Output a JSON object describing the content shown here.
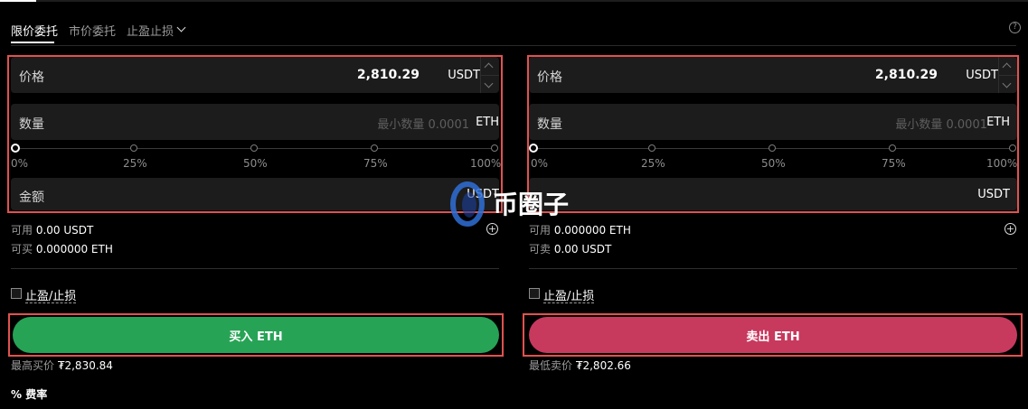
{
  "tabs": {
    "limit": "限价委托",
    "market": "市价委托",
    "tpsl": "止盈止损"
  },
  "buy": {
    "price_label": "价格",
    "price_value": "2,810.29",
    "price_unit": "USDT",
    "qty_label": "数量",
    "qty_placeholder": "最小数量 0.0001",
    "qty_unit": "ETH",
    "slider_marks": [
      "0%",
      "25%",
      "50%",
      "75%",
      "100%"
    ],
    "slider_value_percent": 0,
    "amount_label": "金额",
    "amount_unit": "USDT",
    "available_label": "可用",
    "available_value": "0.00 USDT",
    "can_label": "可买",
    "can_value": "0.000000 ETH",
    "tpsl_label": "止盈/止损",
    "button": "买入 ETH",
    "best_label": "最高买价",
    "best_value": "₮2,830.84",
    "color": "#27a356"
  },
  "sell": {
    "price_label": "价格",
    "price_value": "2,810.29",
    "price_unit": "USDT",
    "qty_label": "数量",
    "qty_placeholder": "最小数量 0.0001",
    "qty_unit": "ETH",
    "slider_marks": [
      "0%",
      "25%",
      "50%",
      "75%",
      "100%"
    ],
    "slider_value_percent": 0,
    "amount_unit": "USDT",
    "available_label": "可用",
    "available_value": "0.000000 ETH",
    "can_label": "可卖",
    "can_value": "0.00 USDT",
    "tpsl_label": "止盈/止损",
    "button": "卖出 ETH",
    "best_label": "最低卖价",
    "best_value": "₮2,802.66",
    "color": "#c8395e"
  },
  "fee": {
    "icon": "%",
    "label": "费率"
  },
  "watermark": "币圈子"
}
